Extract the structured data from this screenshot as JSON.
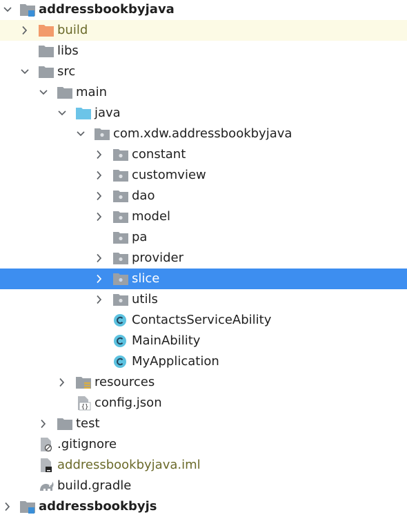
{
  "tree": [
    {
      "label": "addressbookbyjava",
      "depth": 0,
      "expand": "open",
      "icon": "module-folder-icon",
      "bold": true
    },
    {
      "label": "build",
      "depth": 1,
      "expand": "closed",
      "icon": "excluded-folder-icon",
      "style": "olive",
      "highlight": "yellow"
    },
    {
      "label": "libs",
      "depth": 1,
      "expand": "none",
      "icon": "folder-icon"
    },
    {
      "label": "src",
      "depth": 1,
      "expand": "open",
      "icon": "folder-icon"
    },
    {
      "label": "main",
      "depth": 2,
      "expand": "open",
      "icon": "folder-icon"
    },
    {
      "label": "java",
      "depth": 3,
      "expand": "open",
      "icon": "source-folder-icon"
    },
    {
      "label": "com.xdw.addressbookbyjava",
      "depth": 4,
      "expand": "open",
      "icon": "package-icon"
    },
    {
      "label": "constant",
      "depth": 5,
      "expand": "closed",
      "icon": "package-icon"
    },
    {
      "label": "customview",
      "depth": 5,
      "expand": "closed",
      "icon": "package-icon"
    },
    {
      "label": "dao",
      "depth": 5,
      "expand": "closed",
      "icon": "package-icon"
    },
    {
      "label": "model",
      "depth": 5,
      "expand": "closed",
      "icon": "package-icon"
    },
    {
      "label": "pa",
      "depth": 5,
      "expand": "none",
      "icon": "package-icon"
    },
    {
      "label": "provider",
      "depth": 5,
      "expand": "closed",
      "icon": "package-icon"
    },
    {
      "label": "slice",
      "depth": 5,
      "expand": "closed",
      "icon": "package-icon",
      "selected": true
    },
    {
      "label": "utils",
      "depth": 5,
      "expand": "closed",
      "icon": "package-icon"
    },
    {
      "label": "ContactsServiceAbility",
      "depth": 5,
      "expand": "none",
      "icon": "java-class-icon"
    },
    {
      "label": "MainAbility",
      "depth": 5,
      "expand": "none",
      "icon": "java-class-icon"
    },
    {
      "label": "MyApplication",
      "depth": 5,
      "expand": "none",
      "icon": "java-class-icon"
    },
    {
      "label": "resources",
      "depth": 3,
      "expand": "closed",
      "icon": "resources-folder-icon"
    },
    {
      "label": "config.json",
      "depth": 3,
      "expand": "none",
      "icon": "json-file-icon"
    },
    {
      "label": "test",
      "depth": 2,
      "expand": "closed",
      "icon": "folder-icon"
    },
    {
      "label": ".gitignore",
      "depth": 1,
      "expand": "none",
      "icon": "gitignore-file-icon"
    },
    {
      "label": "addressbookbyjava.iml",
      "depth": 1,
      "expand": "none",
      "icon": "iml-file-icon",
      "style": "olive"
    },
    {
      "label": "build.gradle",
      "depth": 1,
      "expand": "none",
      "icon": "gradle-file-icon"
    },
    {
      "label": "addressbookbyjs",
      "depth": 0,
      "expand": "closed",
      "icon": "module-folder-icon",
      "bold": true
    }
  ],
  "colors": {
    "selection": "#3d8ef0",
    "highlight_row": "#fcfae5",
    "folder": "#9aa0a6",
    "excluded_folder": "#f29b6b",
    "source_folder": "#6cc4e8",
    "class_icon": "#5cc2e0",
    "module_badge": "#3a8fd8",
    "olive_text": "#6b6a2a"
  }
}
